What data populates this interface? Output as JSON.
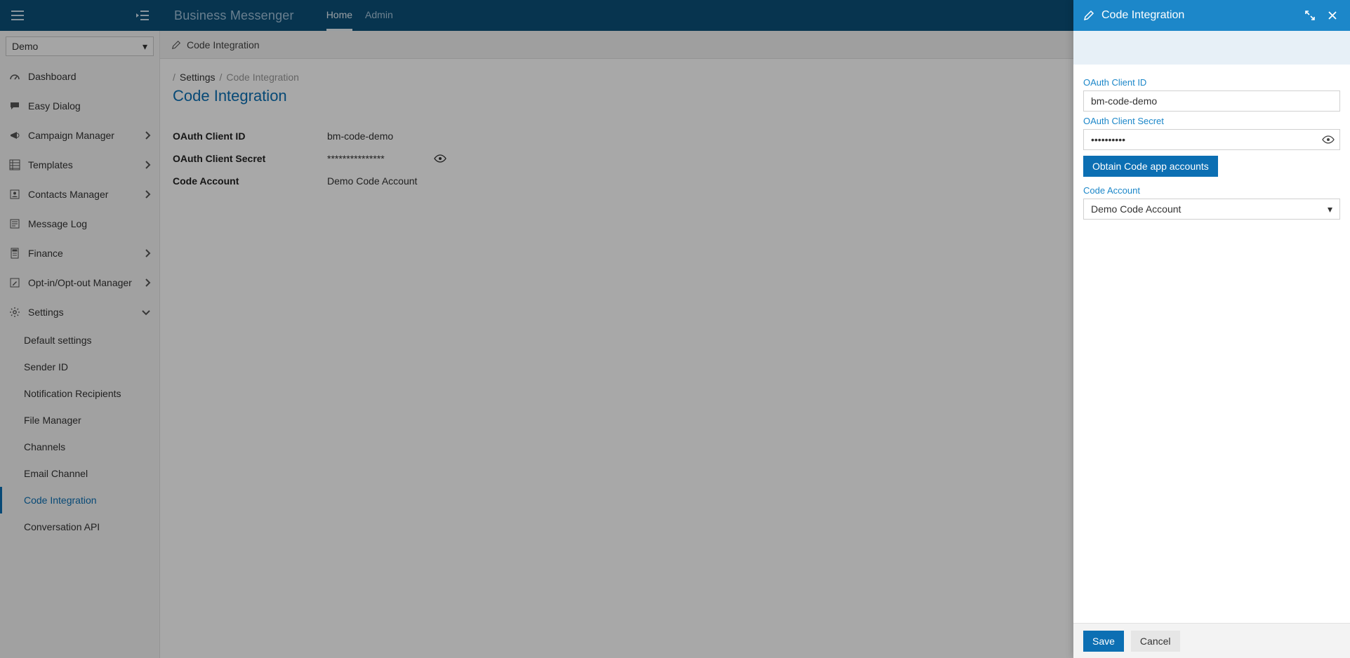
{
  "app": {
    "name": "Business Messenger"
  },
  "topnav": {
    "tabs": [
      {
        "label": "Home",
        "active": true
      },
      {
        "label": "Admin",
        "active": false
      }
    ]
  },
  "scope": {
    "selected": "Demo"
  },
  "sidebar": {
    "items": [
      {
        "label": "Dashboard",
        "icon": "gauge-icon"
      },
      {
        "label": "Easy Dialog",
        "icon": "chat-icon"
      },
      {
        "label": "Campaign Manager",
        "icon": "megaphone-icon",
        "chevron": "right"
      },
      {
        "label": "Templates",
        "icon": "grid-icon",
        "chevron": "right"
      },
      {
        "label": "Contacts Manager",
        "icon": "contacts-icon",
        "chevron": "right"
      },
      {
        "label": "Message Log",
        "icon": "log-icon"
      },
      {
        "label": "Finance",
        "icon": "calculator-icon",
        "chevron": "right"
      },
      {
        "label": "Opt-in/Opt-out Manager",
        "icon": "edit-square-icon",
        "chevron": "right"
      },
      {
        "label": "Settings",
        "icon": "gear-icon",
        "chevron": "down",
        "expanded": true
      }
    ],
    "settings_children": [
      {
        "label": "Default settings"
      },
      {
        "label": "Sender ID"
      },
      {
        "label": "Notification Recipients"
      },
      {
        "label": "File Manager"
      },
      {
        "label": "Channels"
      },
      {
        "label": "Email Channel"
      },
      {
        "label": "Code Integration",
        "active": true
      },
      {
        "label": "Conversation API"
      }
    ]
  },
  "content_header": {
    "title": "Code Integration"
  },
  "breadcrumb": {
    "root_sep": "/",
    "parent": "Settings",
    "sep": "/",
    "current": "Code Integration"
  },
  "page": {
    "title": "Code Integration"
  },
  "details": {
    "client_id_label": "OAuth Client ID",
    "client_id_value": "bm-code-demo",
    "client_secret_label": "OAuth Client Secret",
    "client_secret_value": "***************",
    "account_label": "Code Account",
    "account_value": "Demo Code Account"
  },
  "panel": {
    "title": "Code Integration",
    "fields": {
      "client_id_label": "OAuth Client ID",
      "client_id_value": "bm-code-demo",
      "client_secret_label": "OAuth Client Secret",
      "client_secret_value": "••••••••••",
      "obtain_button": "Obtain Code app accounts",
      "account_label": "Code Account",
      "account_selected": "Demo Code Account"
    },
    "footer": {
      "save": "Save",
      "cancel": "Cancel"
    }
  }
}
